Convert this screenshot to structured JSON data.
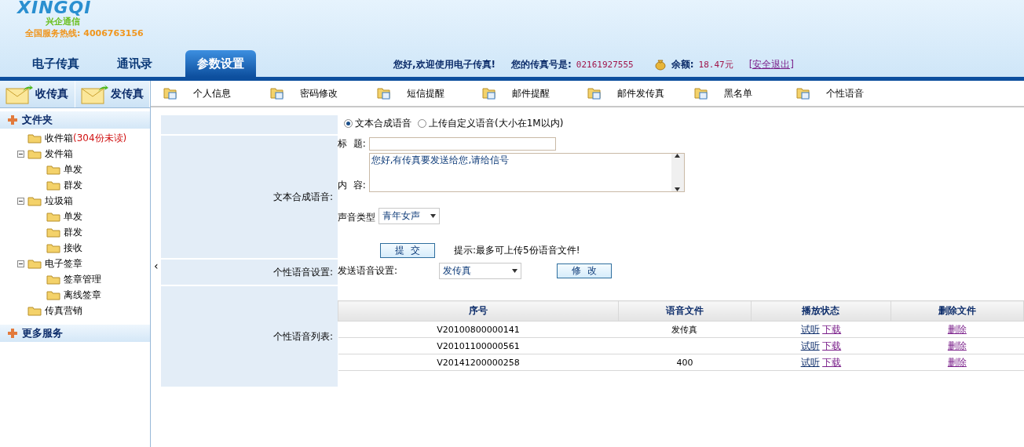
{
  "logo": {
    "wordmark": "XINGQI",
    "name": "兴企通信",
    "hotline": "全国服务热线: 4006763156"
  },
  "nav_tabs": [
    {
      "label": "电子传真",
      "selected": false
    },
    {
      "label": "通讯录",
      "selected": false
    },
    {
      "label": "参数设置",
      "selected": true
    }
  ],
  "user_bar": {
    "greeting": "您好,欢迎使用电子传真!",
    "fax_label": "您的传真号是:",
    "fax_number": "02161927555",
    "balance_label": "余额:",
    "balance": "18.47元",
    "logout": "[安全退出]"
  },
  "quick_buttons": [
    {
      "label": "收传真"
    },
    {
      "label": "发传真"
    }
  ],
  "sidebar": {
    "sections": [
      {
        "title": "文件夹",
        "tree": [
          {
            "label": "收件箱",
            "count": "(304份未读)"
          },
          {
            "label": "发件箱",
            "expanded": true,
            "children": [
              {
                "label": "单发"
              },
              {
                "label": "群发"
              }
            ]
          },
          {
            "label": "垃圾箱",
            "expanded": true,
            "children": [
              {
                "label": "单发"
              },
              {
                "label": "群发"
              },
              {
                "label": "接收"
              }
            ]
          },
          {
            "label": "电子签章",
            "expanded": true,
            "children": [
              {
                "label": "签章管理"
              },
              {
                "label": "离线签章"
              }
            ]
          },
          {
            "label": "传真营销"
          }
        ]
      },
      {
        "title": "更多服务"
      }
    ],
    "collapse": "‹"
  },
  "toolbar": [
    {
      "label": "个人信息"
    },
    {
      "label": "密码修改"
    },
    {
      "label": "短信提醒"
    },
    {
      "label": "邮件提醒"
    },
    {
      "label": "邮件发传真"
    },
    {
      "label": "黑名单"
    },
    {
      "label": "个性语音"
    }
  ],
  "form": {
    "mode_options": [
      {
        "label": "文本合成语音",
        "selected": true
      },
      {
        "label": "上传自定义语音(大小在1M以内)",
        "selected": false
      }
    ],
    "tts_label": "文本合成语音:",
    "title_label": "标  题:",
    "content_label": "内  容:",
    "content_value": "您好,有传真要发送给您,请给信号",
    "voice_type_label": "声音类型",
    "voice_type_value": "青年女声",
    "submit": "提  交",
    "hint": "提示:最多可上传5份语音文件!",
    "setting_label": "个性语音设置:",
    "send_setting_label": "发送语音设置:",
    "send_setting_value": "发传真",
    "modify": "修  改",
    "list_label": "个性语音列表:"
  },
  "table": {
    "columns": [
      "序号",
      "语音文件",
      "播放状态",
      "删除文件"
    ],
    "rows": [
      {
        "id": "V20100800000141",
        "file": "发传真",
        "listen": "试听",
        "download": "下载",
        "delete": "删除"
      },
      {
        "id": "V20101100000561",
        "listen": "试听",
        "download": "下载",
        "delete": "删除"
      },
      {
        "id": "V20141200000258",
        "file": "400",
        "listen": "试听",
        "download": "下载",
        "delete": "删除"
      }
    ]
  }
}
